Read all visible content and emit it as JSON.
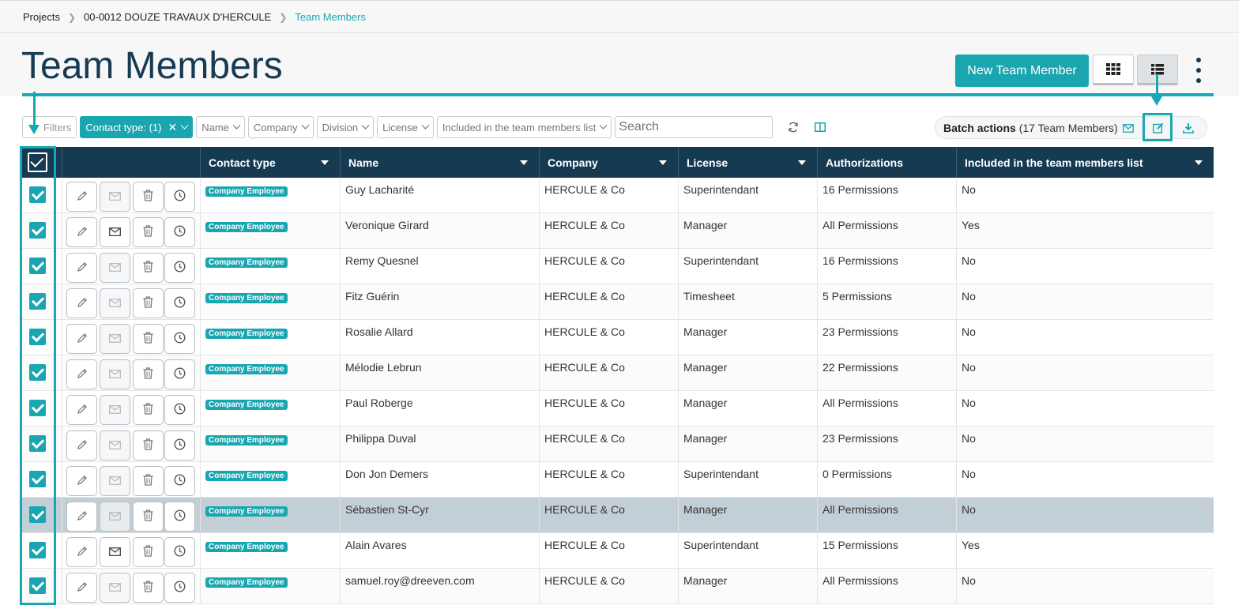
{
  "breadcrumb": {
    "items": [
      "Projects",
      "00-0012 DOUZE TRAVAUX D'HERCULE",
      "Team Members"
    ]
  },
  "page": {
    "title": "Team Members",
    "new_button": "New Team Member",
    "accent_color": "#1aa6b0",
    "header_color": "#163a52"
  },
  "filters": {
    "filters_label": "Filters",
    "contact_type": "Contact type: (1)",
    "name": "Name",
    "company": "Company",
    "division": "Division",
    "license": "License",
    "included": "Included in the team members list",
    "search_placeholder": "Search"
  },
  "batch": {
    "label": "Batch actions",
    "count": "(17 Team Members)"
  },
  "table": {
    "columns": {
      "contact_type": "Contact type",
      "name": "Name",
      "company": "Company",
      "license": "License",
      "authorizations": "Authorizations",
      "included": "Included in the team members list"
    },
    "rows": [
      {
        "contact_type": "Company Employee",
        "name": "Guy Lacharité",
        "company": "HERCULE & Co",
        "license": "Superintendant",
        "authorizations": "16 Permissions",
        "included": "No",
        "email_enabled": false
      },
      {
        "contact_type": "Company Employee",
        "name": "Veronique Girard",
        "company": "HERCULE & Co",
        "license": "Manager",
        "authorizations": "All Permissions",
        "included": "Yes",
        "email_enabled": true
      },
      {
        "contact_type": "Company Employee",
        "name": "Remy Quesnel",
        "company": "HERCULE & Co",
        "license": "Superintendant",
        "authorizations": "16 Permissions",
        "included": "No",
        "email_enabled": false
      },
      {
        "contact_type": "Company Employee",
        "name": "Fitz Guérin",
        "company": "HERCULE & Co",
        "license": "Timesheet",
        "authorizations": "5 Permissions",
        "included": "No",
        "email_enabled": false
      },
      {
        "contact_type": "Company Employee",
        "name": "Rosalie Allard",
        "company": "HERCULE & Co",
        "license": "Manager",
        "authorizations": "23 Permissions",
        "included": "No",
        "email_enabled": false
      },
      {
        "contact_type": "Company Employee",
        "name": "Mélodie Lebrun",
        "company": "HERCULE & Co",
        "license": "Manager",
        "authorizations": "22 Permissions",
        "included": "No",
        "email_enabled": false
      },
      {
        "contact_type": "Company Employee",
        "name": "Paul Roberge",
        "company": "HERCULE & Co",
        "license": "Manager",
        "authorizations": "All Permissions",
        "included": "No",
        "email_enabled": false
      },
      {
        "contact_type": "Company Employee",
        "name": "Philippa Duval",
        "company": "HERCULE & Co",
        "license": "Manager",
        "authorizations": "23 Permissions",
        "included": "No",
        "email_enabled": false
      },
      {
        "contact_type": "Company Employee",
        "name": "Don Jon Demers",
        "company": "HERCULE & Co",
        "license": "Superintendant",
        "authorizations": "0 Permissions",
        "included": "No",
        "email_enabled": false
      },
      {
        "contact_type": "Company Employee",
        "name": "Sébastien St-Cyr",
        "company": "HERCULE & Co",
        "license": "Manager",
        "authorizations": "All Permissions",
        "included": "No",
        "email_enabled": false
      },
      {
        "contact_type": "Company Employee",
        "name": "Alain Avares",
        "company": "HERCULE & Co",
        "license": "Superintendant",
        "authorizations": "15 Permissions",
        "included": "Yes",
        "email_enabled": true
      },
      {
        "contact_type": "Company Employee",
        "name": "samuel.roy@dreeven.com",
        "company": "HERCULE & Co",
        "license": "Manager",
        "authorizations": "All Permissions",
        "included": "No",
        "email_enabled": false
      }
    ]
  }
}
